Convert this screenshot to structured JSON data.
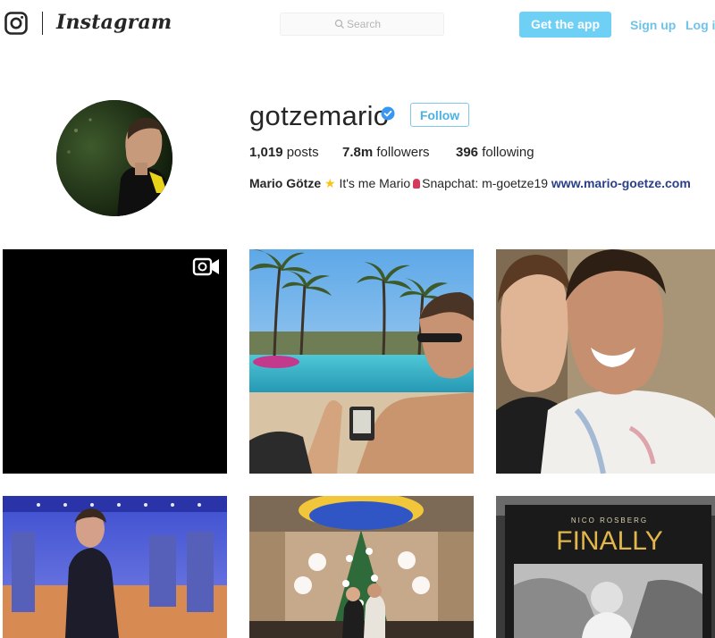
{
  "header": {
    "logo_text": "Instagram",
    "search_placeholder": "Search",
    "get_app_label": "Get the app",
    "signup_label": "Sign up",
    "login_label": "Log in"
  },
  "profile": {
    "username": "gotzemario",
    "verified": true,
    "follow_label": "Follow",
    "posts_count": "1,019",
    "posts_label": "posts",
    "followers_count": "7.8m",
    "followers_label": "followers",
    "following_count": "396",
    "following_label": "following",
    "full_name": "Mario Götze",
    "bio_part1": "It's me Mario",
    "bio_part2": "Snapchat: m-goetze19",
    "website": "www.mario-goetze.com"
  },
  "posts": [
    {
      "type": "video",
      "icon": "video-camera-icon"
    },
    {
      "type": "photo"
    },
    {
      "type": "photo"
    },
    {
      "type": "photo"
    },
    {
      "type": "photo"
    },
    {
      "type": "photo",
      "overlay_text_small": "NICO ROSBERG",
      "overlay_text_large": "FINALLY"
    }
  ],
  "colors": {
    "accent_button": "#6fd0f5",
    "link": "#6fc3e9",
    "verified_badge": "#3897f0",
    "website_link": "#2a3f87"
  }
}
